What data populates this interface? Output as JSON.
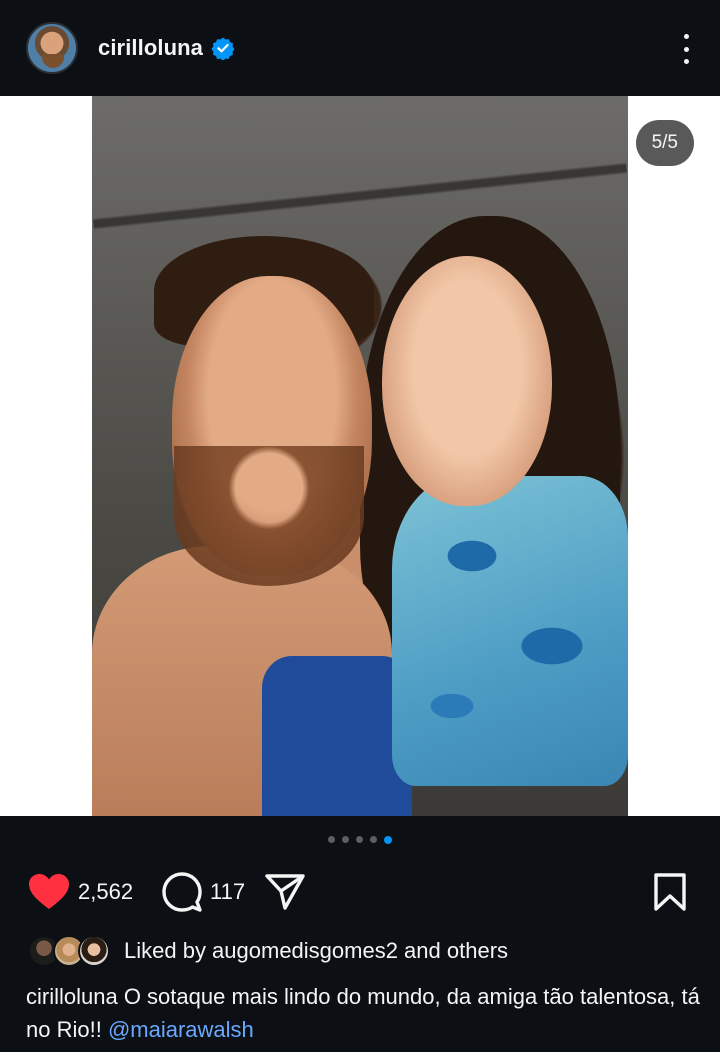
{
  "header": {
    "username": "cirilloluna",
    "verified_icon": "verified-badge-icon",
    "more_icon": "more-vertical-icon"
  },
  "media": {
    "counter": "5/5",
    "current_slide": 5,
    "total_slides": 5
  },
  "actions": {
    "like_count": "2,562",
    "comment_count": "117",
    "like_icon": "heart-filled-icon",
    "comment_icon": "comment-icon",
    "share_icon": "send-icon",
    "save_icon": "bookmark-icon"
  },
  "likes": {
    "text": "Liked by augomedisgomes2 and others"
  },
  "caption": {
    "username": "cirilloluna",
    "text": " O sotaque mais lindo do mundo, da amiga tão talentosa, tá no Rio!! ",
    "mention": "@maiarawalsh"
  },
  "colors": {
    "background": "#0c1014",
    "like_red": "#ff3040",
    "verified_blue": "#0095f6",
    "mention_blue": "#6aa8ff",
    "active_dot": "#0095f6"
  }
}
